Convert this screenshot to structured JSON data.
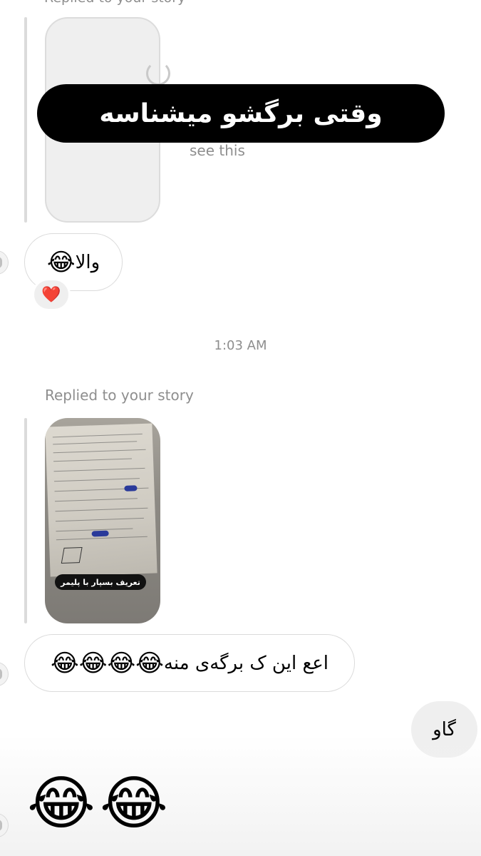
{
  "chat": {
    "top_cut_text": "Replied to your story",
    "story1": {
      "caption": "see this"
    },
    "overlay": {
      "text": "وقتی برگشو میشناسه"
    },
    "msg1": {
      "text": "والا",
      "emoji": "😂",
      "reaction": "❤️"
    },
    "timestamp": "1:03 AM",
    "replied_label": "Replied to your story",
    "story2": {
      "caption": "تعریف بسپار با پلیمر"
    },
    "msg2": {
      "text": "اعع این ک برگه‌ی منه",
      "emoji": "😂😂😂😂"
    },
    "outgoing": {
      "text": "گاو"
    },
    "big_emoji": [
      "😂",
      "😂"
    ]
  },
  "colors": {
    "meta_text": "#8e8e8e",
    "bubble_border": "#dbdbdb",
    "outgoing_bg": "#efefef",
    "banner_bg": "#000000",
    "reaction_heart": "#e0245e"
  }
}
